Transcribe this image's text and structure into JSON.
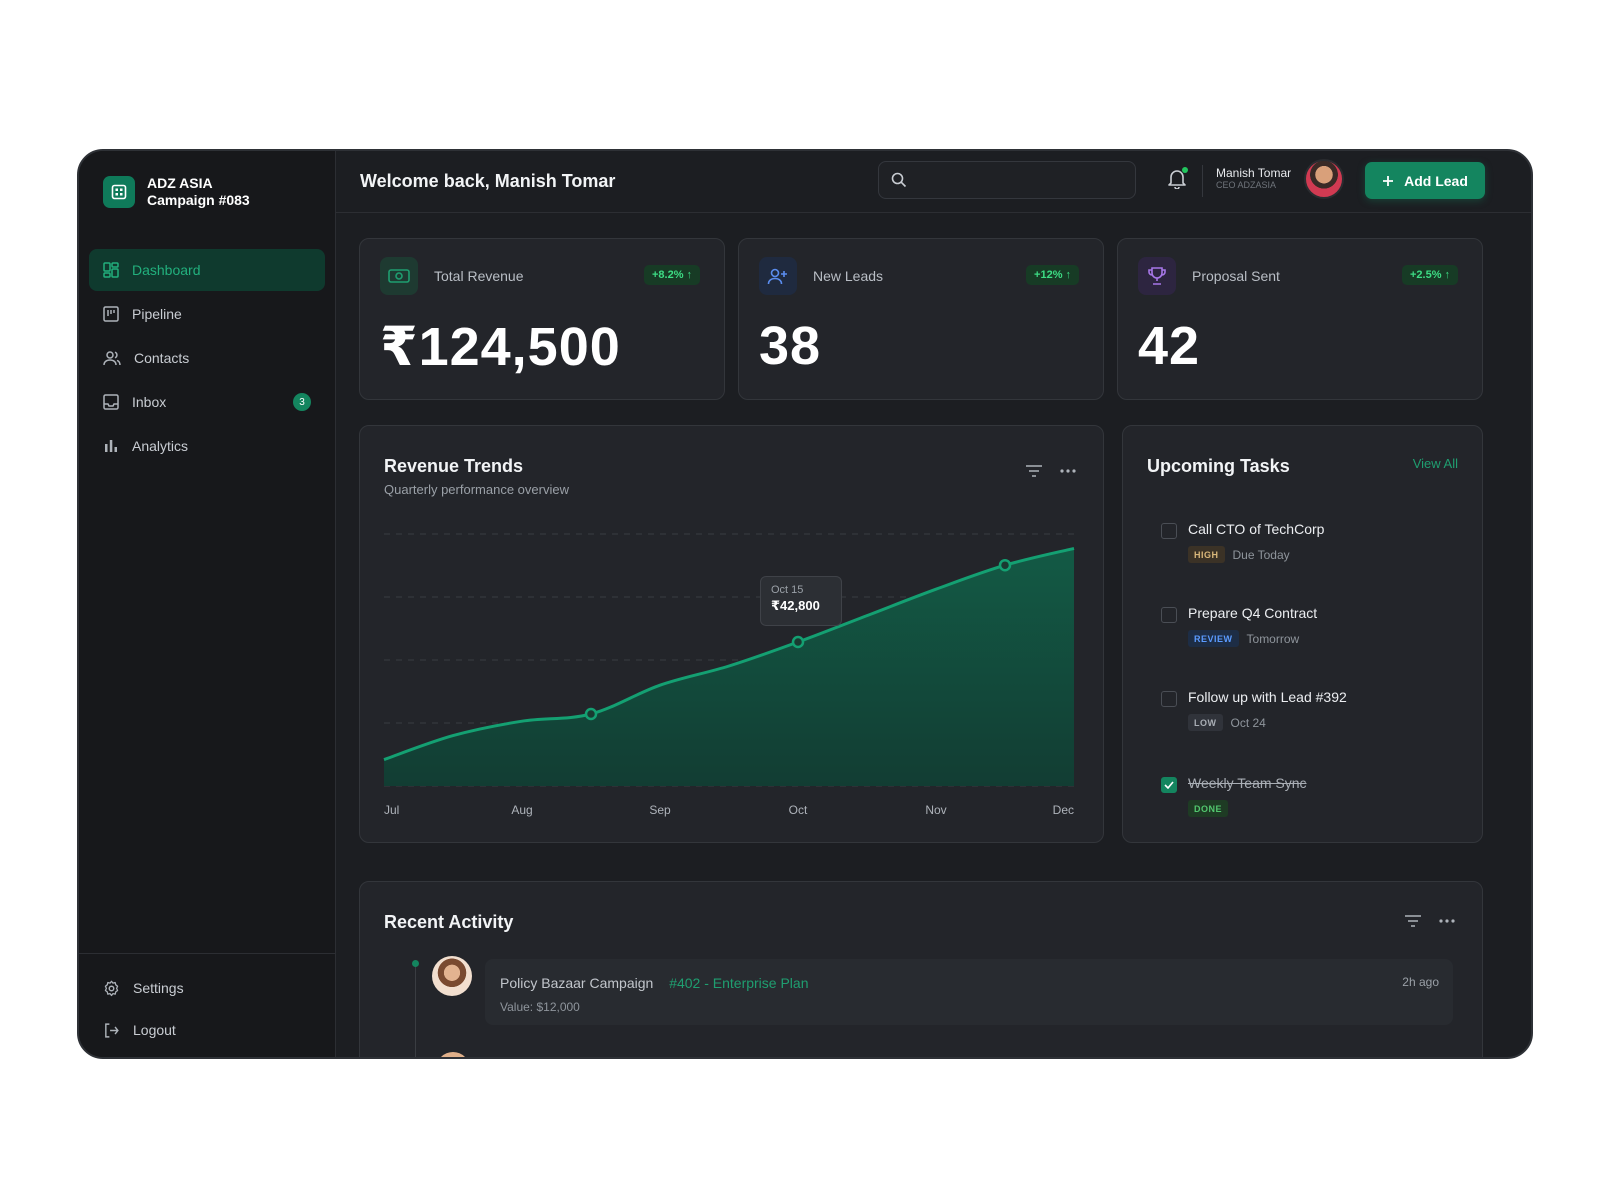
{
  "brand": {
    "line1": "ADZ ASIA",
    "line2": "Campaign #083",
    "logo_icon": "grid-icon"
  },
  "sidebar": {
    "items": [
      {
        "label": "Dashboard",
        "icon": "dashboard-icon",
        "active": true
      },
      {
        "label": "Pipeline",
        "icon": "kanban-icon"
      },
      {
        "label": "Contacts",
        "icon": "users-icon"
      },
      {
        "label": "Inbox",
        "icon": "inbox-icon",
        "badge": "3"
      },
      {
        "label": "Analytics",
        "icon": "bar-chart-icon"
      }
    ],
    "bottom": [
      {
        "label": "Settings",
        "icon": "gear-icon"
      },
      {
        "label": "Logout",
        "icon": "logout-icon"
      }
    ]
  },
  "header": {
    "welcome": "Welcome back, Manish Tomar",
    "search_placeholder": "",
    "user_name": "Manish Tomar",
    "user_role": "CEO ADZASIA",
    "add_button": "Add Lead"
  },
  "stats": [
    {
      "label": "Total Revenue",
      "change": "+8.2%",
      "value": "₹124,500",
      "icon": "money-icon",
      "icon_color": "#1f9e70",
      "icon_bg": "#1e3a31"
    },
    {
      "label": "New Leads",
      "change": "+12%",
      "value": "38",
      "icon": "user-plus-icon",
      "icon_color": "#5b8def",
      "icon_bg": "#1f2a3f"
    },
    {
      "label": "Proposal Sent",
      "change": "+2.5%",
      "value": "42",
      "icon": "trophy-icon",
      "icon_color": "#a777e8",
      "icon_bg": "#2d2540"
    }
  ],
  "revenue": {
    "title": "Revenue Trends",
    "subtitle": "Quarterly performance overview",
    "tooltip_date": "Oct 15",
    "tooltip_value": "₹42,800"
  },
  "chart_data": {
    "type": "area",
    "categories": [
      "Jul",
      "Aug",
      "Sep",
      "Oct",
      "Nov",
      "Dec"
    ],
    "points": [
      {
        "x": 0,
        "y": 0.11
      },
      {
        "x": 0.1,
        "y": 0.21
      },
      {
        "x": 0.2,
        "y": 0.27
      },
      {
        "x": 0.3,
        "y": 0.3
      },
      {
        "x": 0.4,
        "y": 0.42
      },
      {
        "x": 0.5,
        "y": 0.5
      },
      {
        "x": 0.6,
        "y": 0.6
      },
      {
        "x": 0.7,
        "y": 0.71
      },
      {
        "x": 0.8,
        "y": 0.82
      },
      {
        "x": 0.9,
        "y": 0.92
      },
      {
        "x": 1.0,
        "y": 0.99
      }
    ],
    "markers": [
      0.3,
      0.6,
      0.9
    ],
    "gridlines": 5,
    "ylim": [
      0,
      1.05
    ]
  },
  "tasks": {
    "title": "Upcoming Tasks",
    "view_all": "View All",
    "items": [
      {
        "title": "Call CTO of TechCorp",
        "tag": "HIGH",
        "tag_type": "high",
        "due": "Due Today",
        "done": false
      },
      {
        "title": "Prepare Q4 Contract",
        "tag": "REVIEW",
        "tag_type": "review",
        "due": "Tomorrow",
        "done": false
      },
      {
        "title": "Follow up with Lead #392",
        "tag": "LOW",
        "tag_type": "low",
        "due": "Oct 24",
        "done": false
      },
      {
        "title": "Weekly Team Sync",
        "tag": "DONE",
        "tag_type": "done",
        "due": "",
        "done": true
      }
    ]
  },
  "activity": {
    "title": "Recent Activity",
    "items": [
      {
        "title": "Policy Bazaar Campaign",
        "plan": "#402 - Enterprise Plan",
        "value": "Value: $12,000",
        "time": "2h ago"
      }
    ]
  }
}
